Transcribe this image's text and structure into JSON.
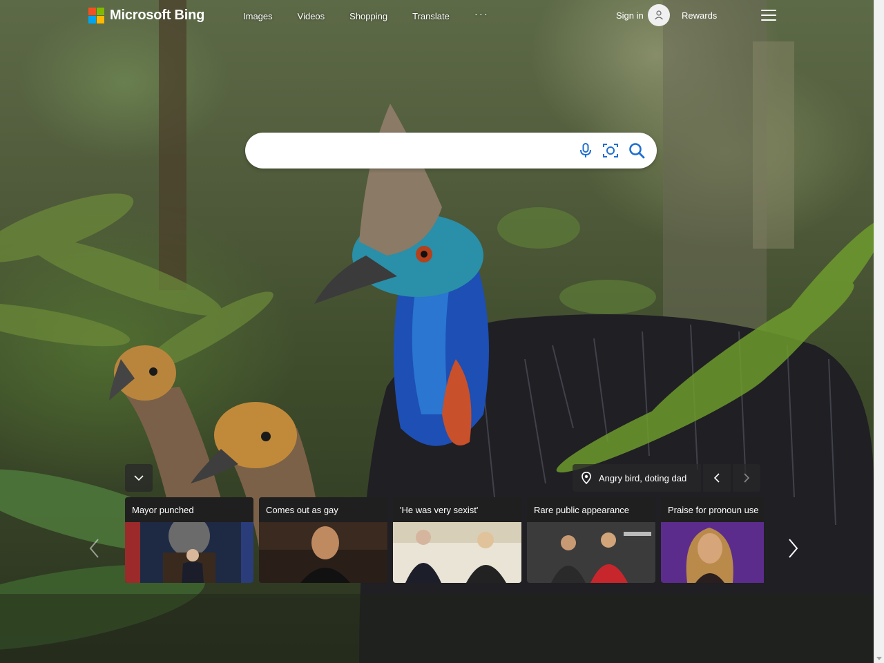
{
  "header": {
    "brand": "Microsoft Bing",
    "nav": [
      "Images",
      "Videos",
      "Shopping",
      "Translate"
    ],
    "more_label": "···",
    "signin_label": "Sign in",
    "rewards_label": "Rewards"
  },
  "search": {
    "query": "",
    "icons": [
      "microphone-icon",
      "visual-search-icon",
      "search-icon"
    ]
  },
  "image_info": {
    "label": "Angry bird, doting dad"
  },
  "news_cards": [
    {
      "title": "Mayor punched"
    },
    {
      "title": "Comes out as gay"
    },
    {
      "title": "'He was very sexist'"
    },
    {
      "title": "Rare public appearance"
    },
    {
      "title": "Praise for pronoun use"
    }
  ],
  "colors": {
    "ms_red": "#f25022",
    "ms_green": "#7fba00",
    "ms_blue": "#00a4ef",
    "ms_yellow": "#ffb900",
    "search_icon_blue": "#1f6fd1"
  }
}
